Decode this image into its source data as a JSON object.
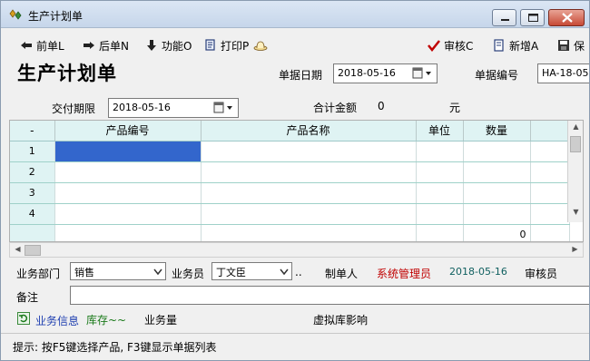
{
  "window": {
    "title": "生产计划单",
    "controls": [
      "minimize",
      "maximize",
      "close"
    ]
  },
  "toolbar": {
    "prev_label": "前单L",
    "next_label": "后单N",
    "function_label": "功能O",
    "print_label": "打印P",
    "review_label": "审核C",
    "add_label": "新增A",
    "save_label": "保"
  },
  "header": {
    "page_title": "生产计划单",
    "doc_date_label": "单据日期",
    "doc_date_value": "2018-05-16",
    "doc_no_label": "单据编号",
    "doc_no_value": "HA-18-05",
    "delivery_label": "交付期限",
    "delivery_value": "2018-05-16",
    "total_label": "合计金额",
    "total_value": "0",
    "currency_label": "元"
  },
  "grid": {
    "corner": "-",
    "columns": [
      "产品编号",
      "产品名称",
      "单位",
      "数量"
    ],
    "row_numbers": [
      "1",
      "2",
      "3",
      "4"
    ],
    "total_quantity": "0"
  },
  "footer": {
    "dept_label": "业务部门",
    "dept_value": "销售",
    "staff_label": "业务员",
    "staff_value": "丁文臣",
    "ellipsis": "..",
    "maker_label": "制单人",
    "maker_value": "系统管理员",
    "maker_date": "2018-05-16",
    "reviewer_label": "审核员",
    "remark_label": "备注",
    "remark_value": "",
    "biz_info_label": "业务信息",
    "stock_label": "库存~~",
    "biz_amount_label": "业务量",
    "virtual_stock_label": "虚拟库影响"
  },
  "status": {
    "hint": "提示: 按F5键选择产品, F3键显示单据列表"
  },
  "colors": {
    "accent_red": "#c00000",
    "grid_header": "#dff3f3",
    "selected_cell": "#3366cc"
  }
}
